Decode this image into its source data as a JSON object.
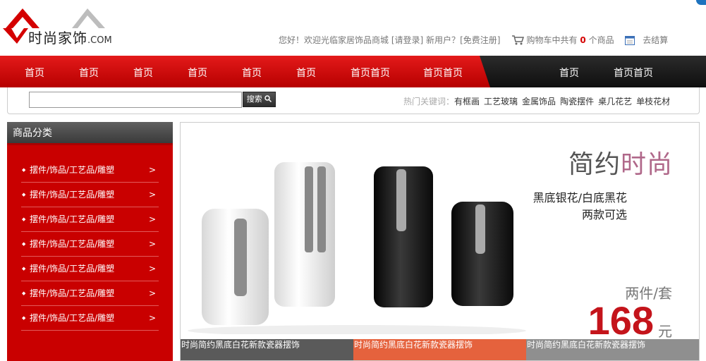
{
  "logo": {
    "name": "时尚家饰",
    "suffix": ".COM"
  },
  "topbar": {
    "greeting": "您好！欢迎光临家居饰品商城",
    "login": "[请登录]",
    "new_user": "新用户？",
    "register": "[免费注册]",
    "cart_prefix": "购物车中共有",
    "cart_count": "0",
    "cart_suffix": "个商品",
    "checkout": "去结算"
  },
  "nav": {
    "items": [
      "首页",
      "首页",
      "首页",
      "首页",
      "首页",
      "首页",
      "首页首页",
      "首页首页",
      "首页",
      "首页首页"
    ]
  },
  "search": {
    "placeholder": "",
    "button": "搜索",
    "hot_label": "热门关键词：",
    "keywords": [
      "有框画",
      "工艺玻璃",
      "金属饰品",
      "陶瓷摆件",
      "桌几花艺",
      "单枝花材"
    ]
  },
  "sidebar": {
    "title": "商品分类",
    "items": [
      "摆件/饰品/工艺品/雕塑",
      "摆件/饰品/工艺品/雕塑",
      "摆件/饰品/工艺品/雕塑",
      "摆件/饰品/工艺品/雕塑",
      "摆件/饰品/工艺品/雕塑",
      "摆件/饰品/工艺品/雕塑",
      "摆件/饰品/工艺品/雕塑"
    ],
    "arrow": ">"
  },
  "banner": {
    "title_plain": "简约",
    "title_accent": "时尚",
    "sub1": "黑底银花/白底黑花",
    "sub2": "两款可选",
    "pair": "两件/套",
    "price": "168",
    "unit": "元",
    "thumbs": [
      "时尚简约黑底白花新款瓷器摆饰",
      "时尚简约黑底白花新款瓷器摆饰",
      "时尚简约黑底白花新款瓷器摆饰"
    ]
  },
  "colors": {
    "brand_red": "#c90000",
    "price_red": "#c4141b",
    "accent_pink": "#b0688a"
  }
}
